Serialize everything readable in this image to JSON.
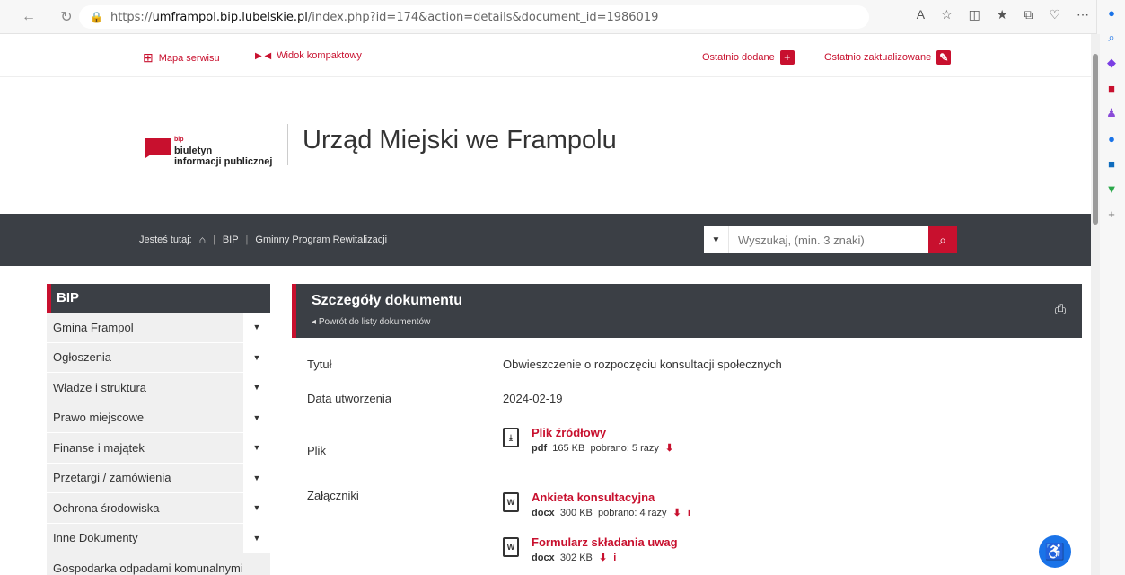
{
  "browser": {
    "url_prefix": "https://",
    "url_host": "umframpol.bip.lubelskie.pl",
    "url_path": "/index.php?id=174&action=details&document_id=1986019"
  },
  "topbar": {
    "sitemap": "Mapa serwisu",
    "compact": "Widok kompaktowy",
    "recent_added": "Ostatnio dodane",
    "recent_updated": "Ostatnio zaktualizowane"
  },
  "header": {
    "logo_bip": "bip",
    "logo_line1": "biuletyn",
    "logo_line2": "informacji publicznej",
    "title": "Urząd Miejski we Frampolu"
  },
  "breadcrumb": {
    "prefix": "Jesteś tutaj:",
    "items": [
      "BIP",
      "Gminny Program Rewitalizacji"
    ]
  },
  "search": {
    "placeholder": "Wyszukaj, (min. 3 znaki)"
  },
  "sidebar": {
    "title": "BIP",
    "items": [
      "Gmina Frampol",
      "Ogłoszenia",
      "Władze i struktura",
      "Prawo miejscowe",
      "Finanse i majątek",
      "Przetargi / zamówienia",
      "Ochrona środowiska",
      "Inne Dokumenty",
      "Gospodarka odpadami komunalnymi"
    ]
  },
  "document": {
    "heading": "Szczegóły dokumentu",
    "back": "Powrót do listy dokumentów",
    "title_label": "Tytuł",
    "title_value": "Obwieszczenie o rozpoczęciu konsultacji społecznych",
    "date_label": "Data utworzenia",
    "date_value": "2024-02-19",
    "file_label": "Plik",
    "attachments_label": "Załączniki",
    "source_file": {
      "name": "Plik źródłowy",
      "ext": "pdf",
      "size": "165 KB",
      "downloads": "pobrano: 5 razy"
    },
    "attachments": [
      {
        "name": "Ankieta konsultacyjna",
        "ext": "docx",
        "size": "300 KB",
        "downloads": "pobrano: 4 razy"
      },
      {
        "name": "Formularz składania uwag",
        "ext": "docx",
        "size": "302 KB",
        "downloads": ""
      }
    ]
  }
}
